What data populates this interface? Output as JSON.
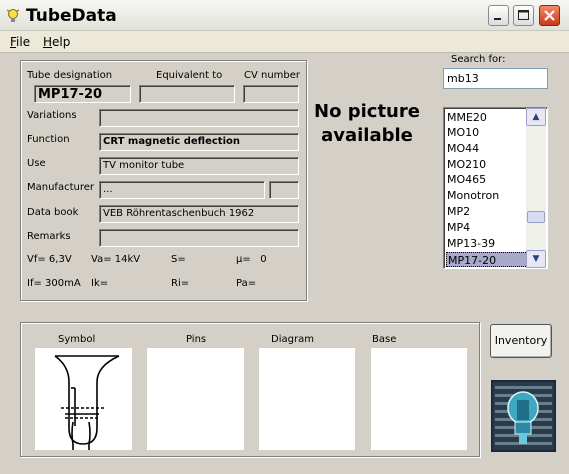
{
  "window": {
    "title": "TubeData"
  },
  "menu": [
    "File",
    "Help"
  ],
  "record": {
    "designation_label": "Tube designation",
    "designation": "MP17-20",
    "equivalent_label": "Equivalent to",
    "equivalent": "",
    "cv_label": "CV number",
    "cv": "",
    "variations_label": "Variations",
    "variations": "",
    "function_label": "Function",
    "function": "CRT magnetic deflection",
    "use_label": "Use",
    "use": "TV monitor tube",
    "manufacturer_label": "Manufacturer",
    "manufacturer": "...",
    "manufacturer_code": "",
    "databook_label": "Data book",
    "databook": "VEB Röhrentaschenbuch 1962",
    "remarks_label": "Remarks",
    "remarks": ""
  },
  "params": {
    "vf": "Vf= 6,3V",
    "va": "Va= 14kV",
    "s": "S=",
    "mu": "µ=   0",
    "if": "If= 300mA",
    "ik": "Ik=",
    "ri": "Ri=",
    "pa": "Pa="
  },
  "picture": {
    "no_picture_text": "No picture available"
  },
  "search": {
    "label": "Search for:",
    "value": "mb13"
  },
  "tube_list": {
    "items": [
      "MME20",
      "MO10",
      "MO44",
      "MO210",
      "MO465",
      "Monotron",
      "MP2",
      "MP4",
      "MP13-39",
      "MP17-20"
    ],
    "selected": "MP17-20"
  },
  "bottom_panels": [
    "Symbol",
    "Pins",
    "Diagram",
    "Base"
  ],
  "buttons": {
    "inventory": "Inventory"
  },
  "icons": {
    "app": "tube-lamp-icon",
    "minimize": "minimize-icon",
    "maximize": "maximize-icon",
    "close": "close-icon",
    "scroll_up": "chevron-up-icon",
    "scroll_down": "chevron-down-icon"
  },
  "colors": {
    "window_bg": "#d4d0c8",
    "close_button": "#c8381a",
    "list_selection": "#a8a8c8"
  }
}
